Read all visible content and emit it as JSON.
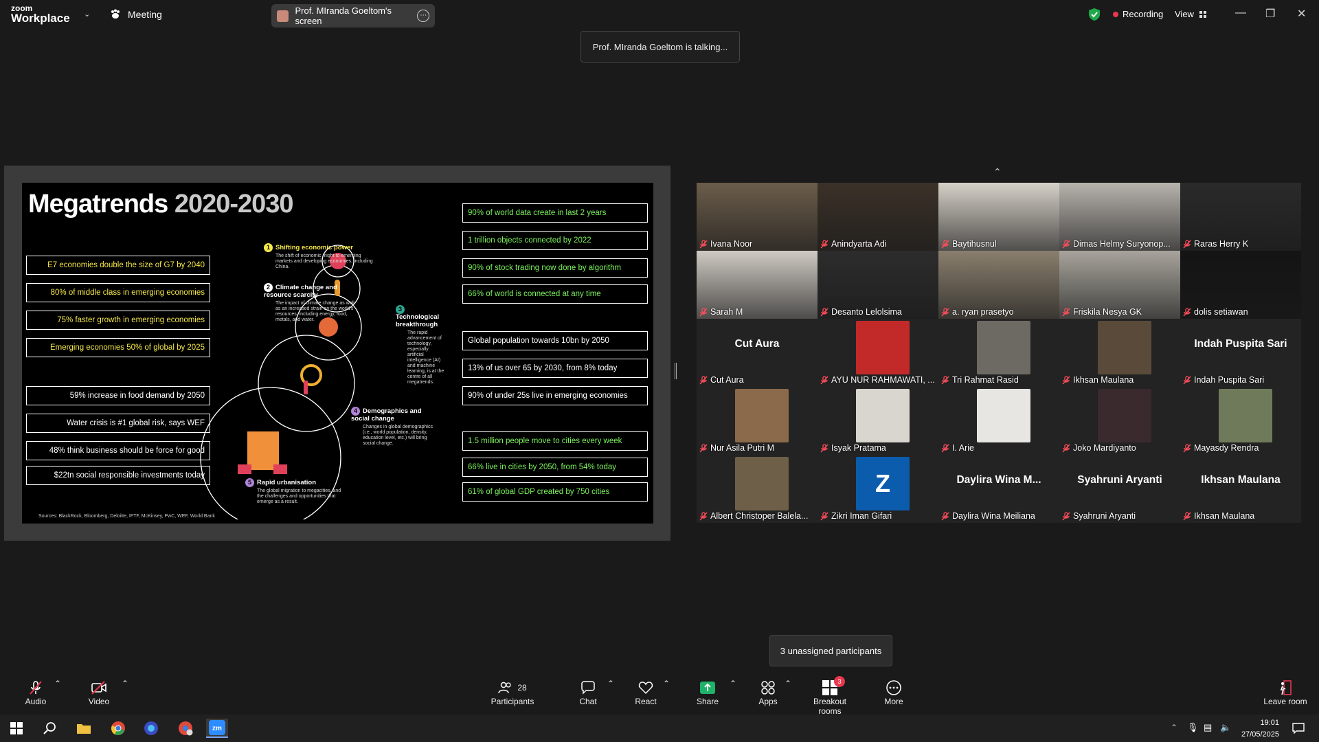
{
  "app": {
    "logo_small": "zoom",
    "logo_large": "Workplace",
    "meeting_label": "Meeting",
    "share_label": "Prof. MIranda Goeltom's screen",
    "recording": "Recording",
    "view": "View",
    "talking": "Prof. MIranda Goeltom is talking..."
  },
  "slide": {
    "title_word": "Megatrends ",
    "title_years": "2020-2030",
    "left_boxes": [
      "E7 economies double the size of G7 by 2040",
      "80% of middle class in emerging economies",
      "75% faster growth in emerging economies",
      "Emerging economies 50% of global by 2025",
      "59% increase in food demand by 2050",
      "Water crisis is #1 global risk, says WEF",
      "48% think business should be force for good",
      "$22tn social responsible investments today"
    ],
    "right_boxes": [
      "90% of world data create in last 2 years",
      "1 trillion objects connected by 2022",
      "90% of stock trading now done by algorithm",
      "66% of world is connected at any time",
      "Global population towards 10bn by 2050",
      "13% of us over 65 by 2030, from 8% today",
      "90% of under 25s live in emerging economies",
      "1.5 million people move to cities every week",
      "66% live in cities by 2050, from 54% today",
      "61% of global GDP created by 750 cities"
    ],
    "trends": [
      {
        "num": "1",
        "title": "Shifting economic power",
        "desc": "The shift of economic might to emerging markets and developing economies, including China."
      },
      {
        "num": "2",
        "title": "Climate change and resource scarcity",
        "desc": "The impact of climate change as well as an increased strain on the world's resources, including energy, food, metals, and water."
      },
      {
        "num": "3",
        "title": "Technological breakthrough",
        "desc": "The rapid advancement of technology, especially artificial intelligence (AI) and machine learning, is at the centre of all megatrends."
      },
      {
        "num": "4",
        "title": "Demographics and social change",
        "desc": "Changes in global demographics (i.e., world population, density, education level, etc.) will bring social change."
      },
      {
        "num": "5",
        "title": "Rapid urbanisation",
        "desc": "The global migration to megacities, and the challenges and opportunities that emerge as a result."
      }
    ],
    "sources": "Sources: BlackRock, Bloomberg, Deloitte, IFTF, McKinsey, PwC, WEF, World Bank"
  },
  "participants": [
    {
      "name": "Ivana Noor",
      "bg": "#6b5d4a"
    },
    {
      "name": "Anindyarta Adi",
      "bg": "#3b3128"
    },
    {
      "name": "Baytihusnul",
      "bg": "#d6d1c8"
    },
    {
      "name": "Dimas Helmy Suryonop...",
      "bg": "#b7b3ad"
    },
    {
      "name": "Raras Herry K",
      "bg": "#2a2a2a"
    },
    {
      "name": "Sarah M",
      "bg": "#cfcac3"
    },
    {
      "name": "Desanto Lelolsima",
      "bg": "#2c2c2c"
    },
    {
      "name": "a. ryan prasetyo",
      "bg": "#8a7f6e"
    },
    {
      "name": "Friskila Nesya GK",
      "bg": "#a8a49c"
    },
    {
      "name": "dolis setiawan",
      "bg": "#141414"
    },
    {
      "name": "Cut Aura",
      "big": "Cut Aura"
    },
    {
      "name": "AYU NUR RAHMAWATI, ...",
      "avatar": "#c22a2a"
    },
    {
      "name": "Tri Rahmat Rasid",
      "avatar": "#6d6a64"
    },
    {
      "name": "Ikhsan Maulana",
      "avatar": "#5a4a3a"
    },
    {
      "name": "Indah Puspita Sari",
      "big": "Indah Puspita Sari"
    },
    {
      "name": "Nur Asila Putri M",
      "avatar": "#8a6a4a"
    },
    {
      "name": "Isyak Pratama",
      "avatar": "#d9d5cf"
    },
    {
      "name": "I. Arie",
      "avatar": "#e8e6e2"
    },
    {
      "name": "Joko Mardiyanto",
      "avatar": "#3a2a2e"
    },
    {
      "name": "Mayasdy Rendra",
      "avatar": "#6f7a5a"
    },
    {
      "name": "Albert Christoper Balela...",
      "avatar": "#6e5f48"
    },
    {
      "name": "Zikri Iman Gifari",
      "zletter": "Z"
    },
    {
      "name": "Daylira Wina Meiliana",
      "big": "Daylira  Wina  M..."
    },
    {
      "name": "Syahruni Aryanti",
      "big": "Syahruni Aryanti"
    },
    {
      "name": "Ikhsan Maulana",
      "big": "Ikhsan Maulana"
    }
  ],
  "unassigned": "3 unassigned participants",
  "toolbar": {
    "audio": "Audio",
    "video": "Video",
    "participants": "Participants",
    "participants_count": "28",
    "chat": "Chat",
    "react": "React",
    "share": "Share",
    "apps": "Apps",
    "breakout": "Breakout rooms",
    "breakout_badge": "3",
    "more": "More",
    "leave": "Leave room"
  },
  "taskbar": {
    "time": "19:01",
    "date": "27/05/2025"
  }
}
